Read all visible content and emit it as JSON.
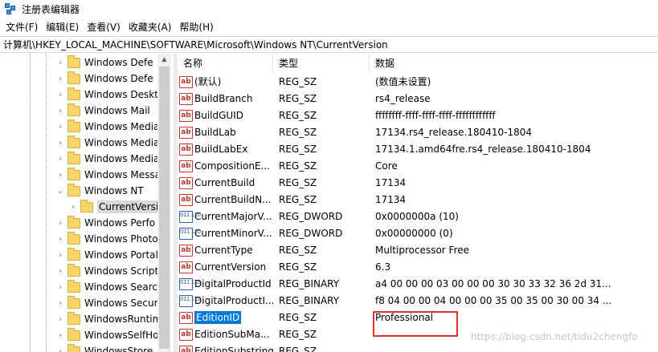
{
  "window": {
    "title": "注册表编辑器"
  },
  "menu": [
    "文件(F)",
    "编辑(E)",
    "查看(V)",
    "收藏夹(A)",
    "帮助(H)"
  ],
  "address": "计算机\\HKEY_LOCAL_MACHINE\\SOFTWARE\\Microsoft\\Windows NT\\CurrentVersion",
  "tree": [
    {
      "label": "Windows Defe",
      "expand": "›"
    },
    {
      "label": "Windows Defe",
      "expand": "›"
    },
    {
      "label": "Windows Deskt",
      "expand": "›"
    },
    {
      "label": "Windows Mail",
      "expand": "›"
    },
    {
      "label": "Windows Media",
      "expand": "›"
    },
    {
      "label": "Windows Media",
      "expand": "›"
    },
    {
      "label": "Windows Media",
      "expand": "›"
    },
    {
      "label": "Windows Messa",
      "expand": "›"
    },
    {
      "label": "Windows NT",
      "expand": "⌄"
    },
    {
      "label": "CurrentVersio",
      "expand": "›"
    },
    {
      "label": "Windows Perfo",
      "expand": "›"
    },
    {
      "label": "Windows Photo",
      "expand": "›"
    },
    {
      "label": "Windows Portal",
      "expand": "›"
    },
    {
      "label": "Windows Script",
      "expand": "›"
    },
    {
      "label": "Windows Search",
      "expand": "›"
    },
    {
      "label": "Windows Securi",
      "expand": "›"
    },
    {
      "label": "WindowsRuntim",
      "expand": "›"
    },
    {
      "label": "WindowsSelfHo",
      "expand": "›"
    },
    {
      "label": "WindowsStore",
      "expand": "›"
    }
  ],
  "columns": {
    "name": "名称",
    "type": "类型",
    "data": "数据"
  },
  "values": [
    {
      "name": "(默认)",
      "type": "REG_SZ",
      "data": "(数值未设置)",
      "icon": "ab"
    },
    {
      "name": "BuildBranch",
      "type": "REG_SZ",
      "data": "rs4_release",
      "icon": "ab"
    },
    {
      "name": "BuildGUID",
      "type": "REG_SZ",
      "data": "ffffffff-ffff-ffff-ffff-ffffffffffff",
      "icon": "ab"
    },
    {
      "name": "BuildLab",
      "type": "REG_SZ",
      "data": "17134.rs4_release.180410-1804",
      "icon": "ab"
    },
    {
      "name": "BuildLabEx",
      "type": "REG_SZ",
      "data": "17134.1.amd64fre.rs4_release.180410-1804",
      "icon": "ab"
    },
    {
      "name": "CompositionE...",
      "type": "REG_SZ",
      "data": "Core",
      "icon": "ab"
    },
    {
      "name": "CurrentBuild",
      "type": "REG_SZ",
      "data": "17134",
      "icon": "ab"
    },
    {
      "name": "CurrentBuildN...",
      "type": "REG_SZ",
      "data": "17134",
      "icon": "ab"
    },
    {
      "name": "CurrentMajorV...",
      "type": "REG_DWORD",
      "data": "0x0000000a (10)",
      "icon": "bin"
    },
    {
      "name": "CurrentMinorV...",
      "type": "REG_DWORD",
      "data": "0x00000000 (0)",
      "icon": "bin"
    },
    {
      "name": "CurrentType",
      "type": "REG_SZ",
      "data": "Multiprocessor Free",
      "icon": "ab"
    },
    {
      "name": "CurrentVersion",
      "type": "REG_SZ",
      "data": "6.3",
      "icon": "ab"
    },
    {
      "name": "DigitalProductId",
      "type": "REG_BINARY",
      "data": "a4 00 00 00 03 00 00 00 30 30 33 32 36 2d 31...",
      "icon": "bin"
    },
    {
      "name": "DigitalProductI...",
      "type": "REG_BINARY",
      "data": "f8 04 00 00 04 00 00 00 35 00 35 00 30 00 34 ...",
      "icon": "bin"
    },
    {
      "name": "EditionID",
      "type": "REG_SZ",
      "data": "Professional",
      "icon": "ab"
    },
    {
      "name": "EditionSubMa...",
      "type": "REG_SZ",
      "data": "",
      "icon": "ab"
    },
    {
      "name": "EditionSubstring",
      "type": "REG_SZ",
      "data": "",
      "icon": "ab"
    }
  ],
  "watermark": "https://blog.csdn.net/tidu2chengfo"
}
